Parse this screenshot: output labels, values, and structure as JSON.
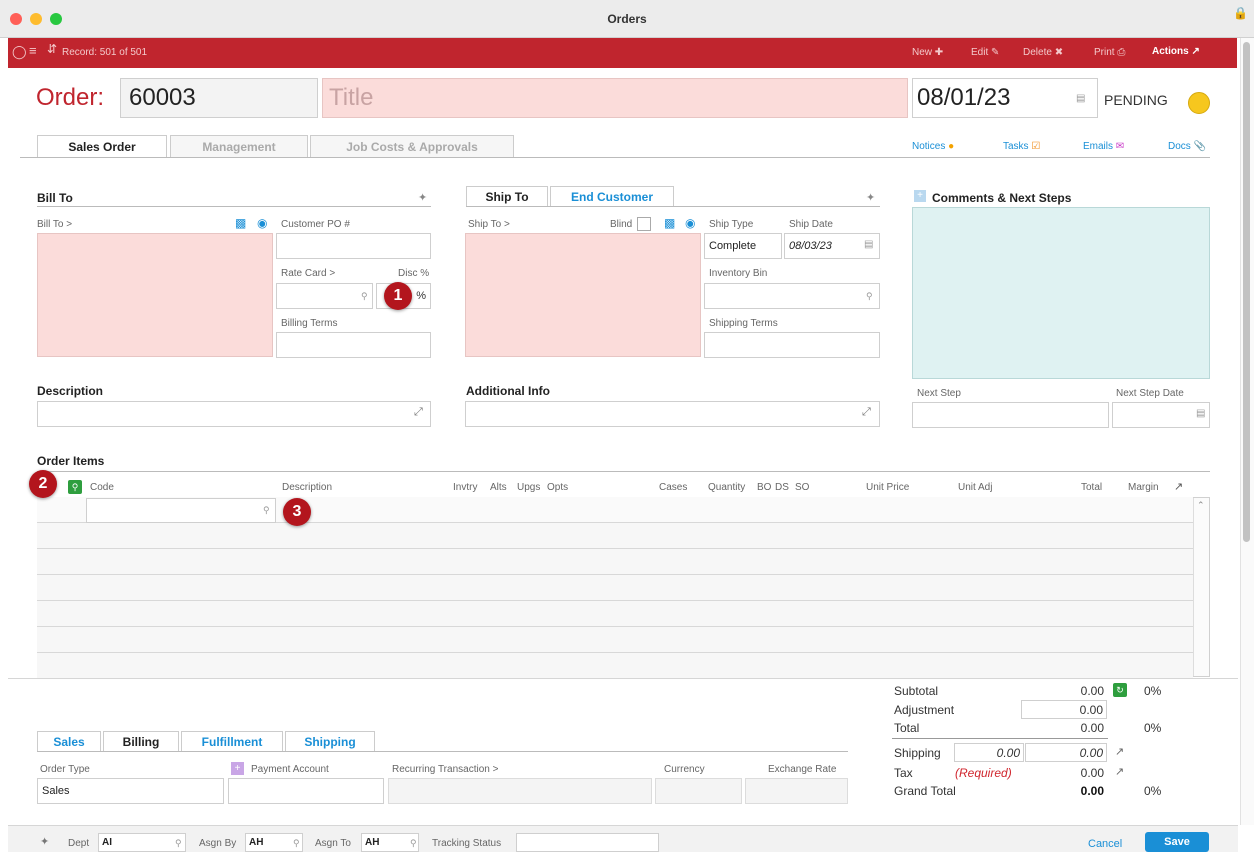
{
  "window": {
    "title": "Orders"
  },
  "toolbar": {
    "record": "Record: 501 of 501",
    "new": "New",
    "edit": "Edit",
    "delete": "Delete",
    "print": "Print",
    "actions": "Actions"
  },
  "header": {
    "order_label": "Order:",
    "order_number": "60003",
    "title_placeholder": "Title",
    "date": "08/01/23",
    "status": "PENDING"
  },
  "tabs": [
    "Sales Order",
    "Management",
    "Job Costs & Approvals"
  ],
  "links": {
    "notices": "Notices",
    "tasks": "Tasks",
    "emails": "Emails",
    "docs": "Docs"
  },
  "bill_to": {
    "title": "Bill To",
    "bill_to_label": "Bill To >",
    "customer_po": "Customer PO #",
    "rate_card": "Rate Card >",
    "disc": "Disc %",
    "disc_tail": "%",
    "billing_terms": "Billing Terms"
  },
  "ship_to": {
    "tab_ship": "Ship To",
    "tab_end": "End Customer",
    "ship_to_label": "Ship To >",
    "blind": "Blind",
    "ship_type_label": "Ship Type",
    "ship_type": "Complete",
    "ship_date_label": "Ship Date",
    "ship_date": "08/03/23",
    "inventory_bin": "Inventory Bin",
    "shipping_terms": "Shipping Terms"
  },
  "comments": {
    "title": "Comments & Next Steps",
    "next_step": "Next Step",
    "next_step_date": "Next Step Date"
  },
  "description": {
    "title": "Description"
  },
  "additional": {
    "title": "Additional Info"
  },
  "order_items": {
    "title": "Order Items",
    "columns": {
      "code": "Code",
      "description": "Description",
      "invtry": "Invtry",
      "alts": "Alts",
      "upgs": "Upgs",
      "opts": "Opts",
      "cases": "Cases",
      "quantity": "Quantity",
      "bo": "BO",
      "ds": "DS",
      "so": "SO",
      "unit_price": "Unit Price",
      "unit_adj": "Unit Adj",
      "total": "Total",
      "margin": "Margin"
    }
  },
  "badges": {
    "b1": "1",
    "b2": "2",
    "b3": "3"
  },
  "totals": {
    "subtotal_label": "Subtotal",
    "subtotal": "0.00",
    "subtotal_pct": "0%",
    "adjustment_label": "Adjustment",
    "adjustment": "0.00",
    "total_label": "Total",
    "total": "0.00",
    "total_pct": "0%",
    "shipping_label": "Shipping",
    "shipping_a": "0.00",
    "shipping_b": "0.00",
    "tax_label": "Tax",
    "tax_note": "(Required)",
    "tax": "0.00",
    "grand_label": "Grand Total",
    "grand": "0.00",
    "grand_pct": "0%"
  },
  "bottom_tabs": [
    "Sales",
    "Billing",
    "Fulfillment",
    "Shipping"
  ],
  "billing": {
    "order_type_label": "Order Type",
    "order_type": "Sales",
    "payment_account": "Payment Account",
    "recurring": "Recurring Transaction >",
    "currency": "Currency",
    "exchange_rate": "Exchange Rate"
  },
  "footer": {
    "dept_label": "Dept",
    "dept": "AI",
    "asgn_by_label": "Asgn By",
    "asgn_by": "AH",
    "asgn_to_label": "Asgn To",
    "asgn_to": "AH",
    "tracking_label": "Tracking Status",
    "cancel": "Cancel",
    "save": "Save"
  },
  "colors": {
    "toolbar": "#c0252e",
    "accent": "#1a8fd6",
    "status": "#f6c71e"
  }
}
